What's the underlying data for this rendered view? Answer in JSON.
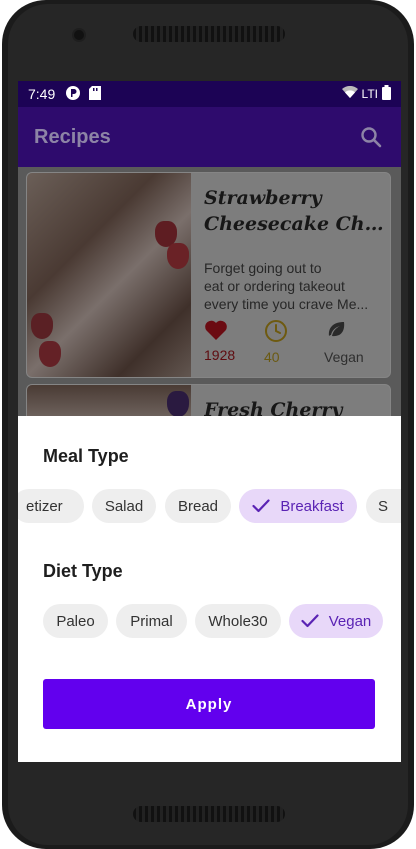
{
  "status_bar": {
    "time": "7:49",
    "network": "LTI"
  },
  "app_bar": {
    "title": "Recipes",
    "search_icon": "search-icon"
  },
  "recipes": [
    {
      "title_lines": [
        "Strawberry",
        "Cheesecake Choc..."
      ],
      "description_lines": [
        "Forget going out to",
        "eat or ordering takeout",
        "every time you crave Me..."
      ],
      "likes": "1928",
      "minutes": "40",
      "diet": "Vegan",
      "colors": {
        "heart": "#6b0b12",
        "clock": "#6e5a10"
      }
    },
    {
      "title_lines": [
        "Fresh Cherry"
      ]
    }
  ],
  "filter_sheet": {
    "meal_type_title": "Meal Type",
    "meal_types": [
      "etizer",
      "Salad",
      "Bread",
      "Breakfast",
      "S"
    ],
    "meal_selected": "Breakfast",
    "diet_type_title": "Diet Type",
    "diet_types": [
      "Paleo",
      "Primal",
      "Whole30",
      "Vegan"
    ],
    "diet_selected": "Vegan",
    "apply_label": "Apply"
  },
  "colors": {
    "primary": "#6200ee",
    "chip_selected_bg": "#e8d8f9",
    "chip_bg": "#eeeeee"
  }
}
